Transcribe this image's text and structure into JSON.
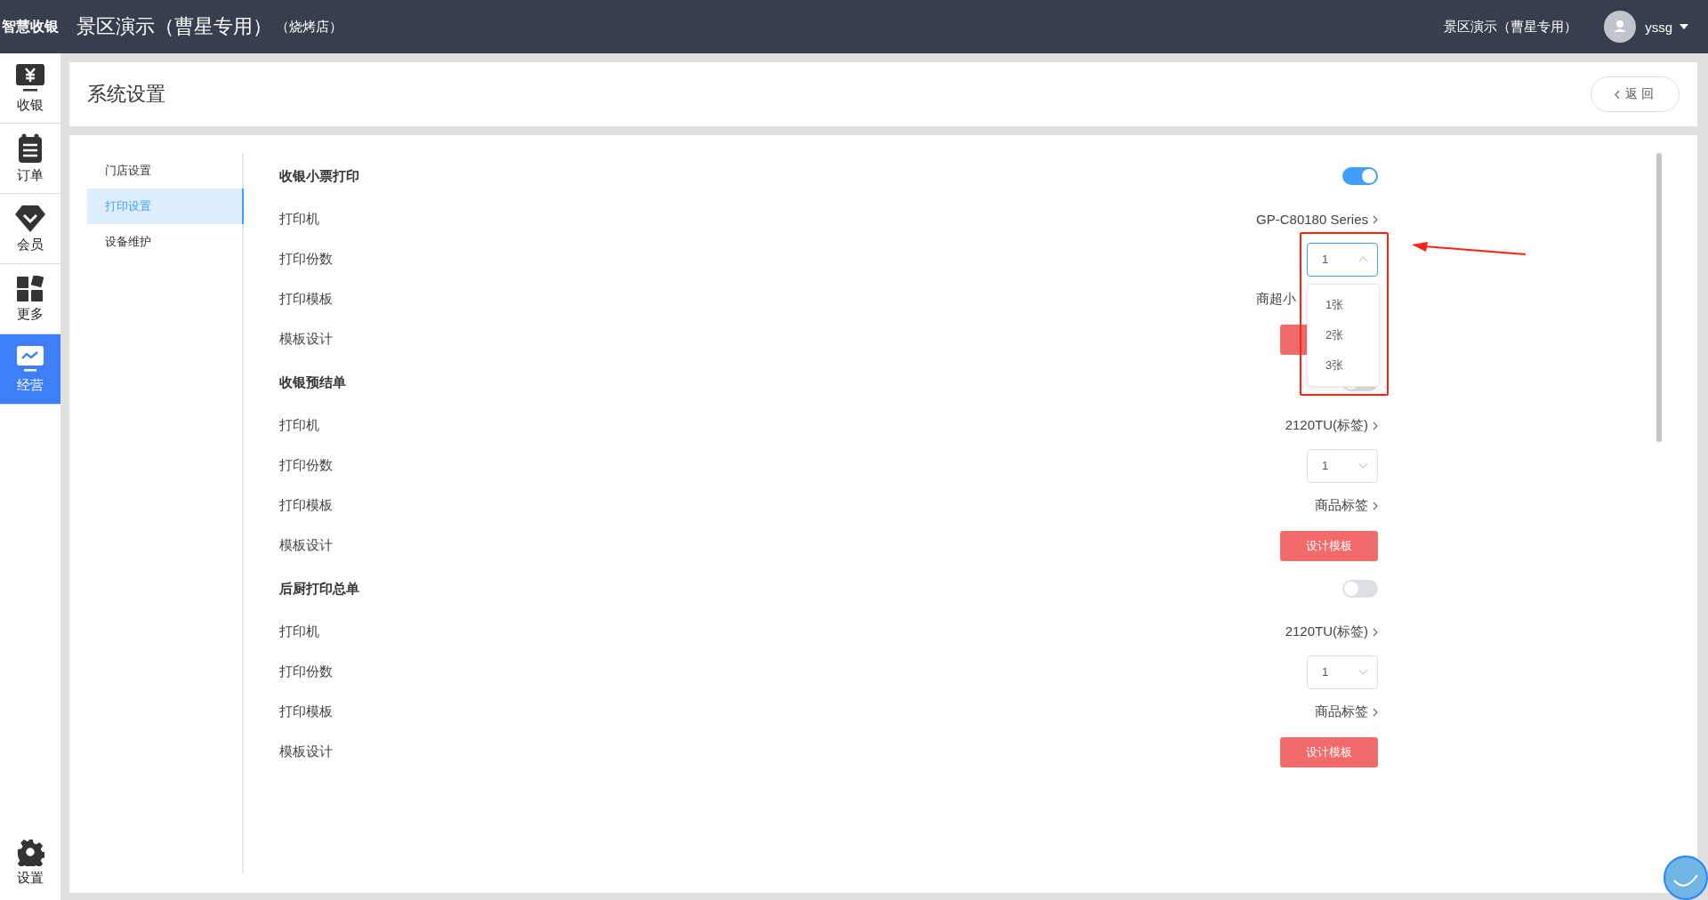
{
  "topbar": {
    "brand": "智慧收银",
    "title": "景区演示（曹星专用）",
    "subtitle": "（烧烤店）",
    "store": "景区演示（曹星专用）",
    "user": "yssg"
  },
  "nav": [
    {
      "label": "收银",
      "selected": false
    },
    {
      "label": "订单",
      "selected": false
    },
    {
      "label": "会员",
      "selected": false
    },
    {
      "label": "更多",
      "selected": false
    },
    {
      "label": "经营",
      "selected": true
    }
  ],
  "nav_bottom": {
    "label": "设置"
  },
  "page": {
    "title": "系统设置",
    "back": "返回"
  },
  "menu": [
    {
      "label": "门店设置",
      "selected": false
    },
    {
      "label": "打印设置",
      "selected": true
    },
    {
      "label": "设备维护",
      "selected": false
    }
  ],
  "sections": [
    {
      "title": "收银小票打印",
      "on": true,
      "rows": [
        {
          "kind": "link",
          "label": "打印机",
          "value": "GP-C80180 Series"
        },
        {
          "kind": "select",
          "label": "打印份数",
          "value": "1",
          "open": true,
          "options": [
            "1张",
            "2张",
            "3张"
          ]
        },
        {
          "kind": "link",
          "label": "打印模板",
          "value": "商超小"
        },
        {
          "kind": "button",
          "label": "模板设计"
        }
      ]
    },
    {
      "title": "收银预结单",
      "on": false,
      "rows": [
        {
          "kind": "link",
          "label": "打印机",
          "value": "2120TU(标签)"
        },
        {
          "kind": "select",
          "label": "打印份数",
          "value": "1",
          "open": false
        },
        {
          "kind": "link",
          "label": "打印模板",
          "value": "商品标签"
        },
        {
          "kind": "button",
          "label": "模板设计",
          "button": "设计模板"
        }
      ]
    },
    {
      "title": "后厨打印总单",
      "on": false,
      "rows": [
        {
          "kind": "link",
          "label": "打印机",
          "value": "2120TU(标签)"
        },
        {
          "kind": "select",
          "label": "打印份数",
          "value": "1",
          "open": false
        },
        {
          "kind": "link",
          "label": "打印模板",
          "value": "商品标签"
        },
        {
          "kind": "button",
          "label": "模板设计",
          "button": "设计模板"
        }
      ]
    }
  ]
}
